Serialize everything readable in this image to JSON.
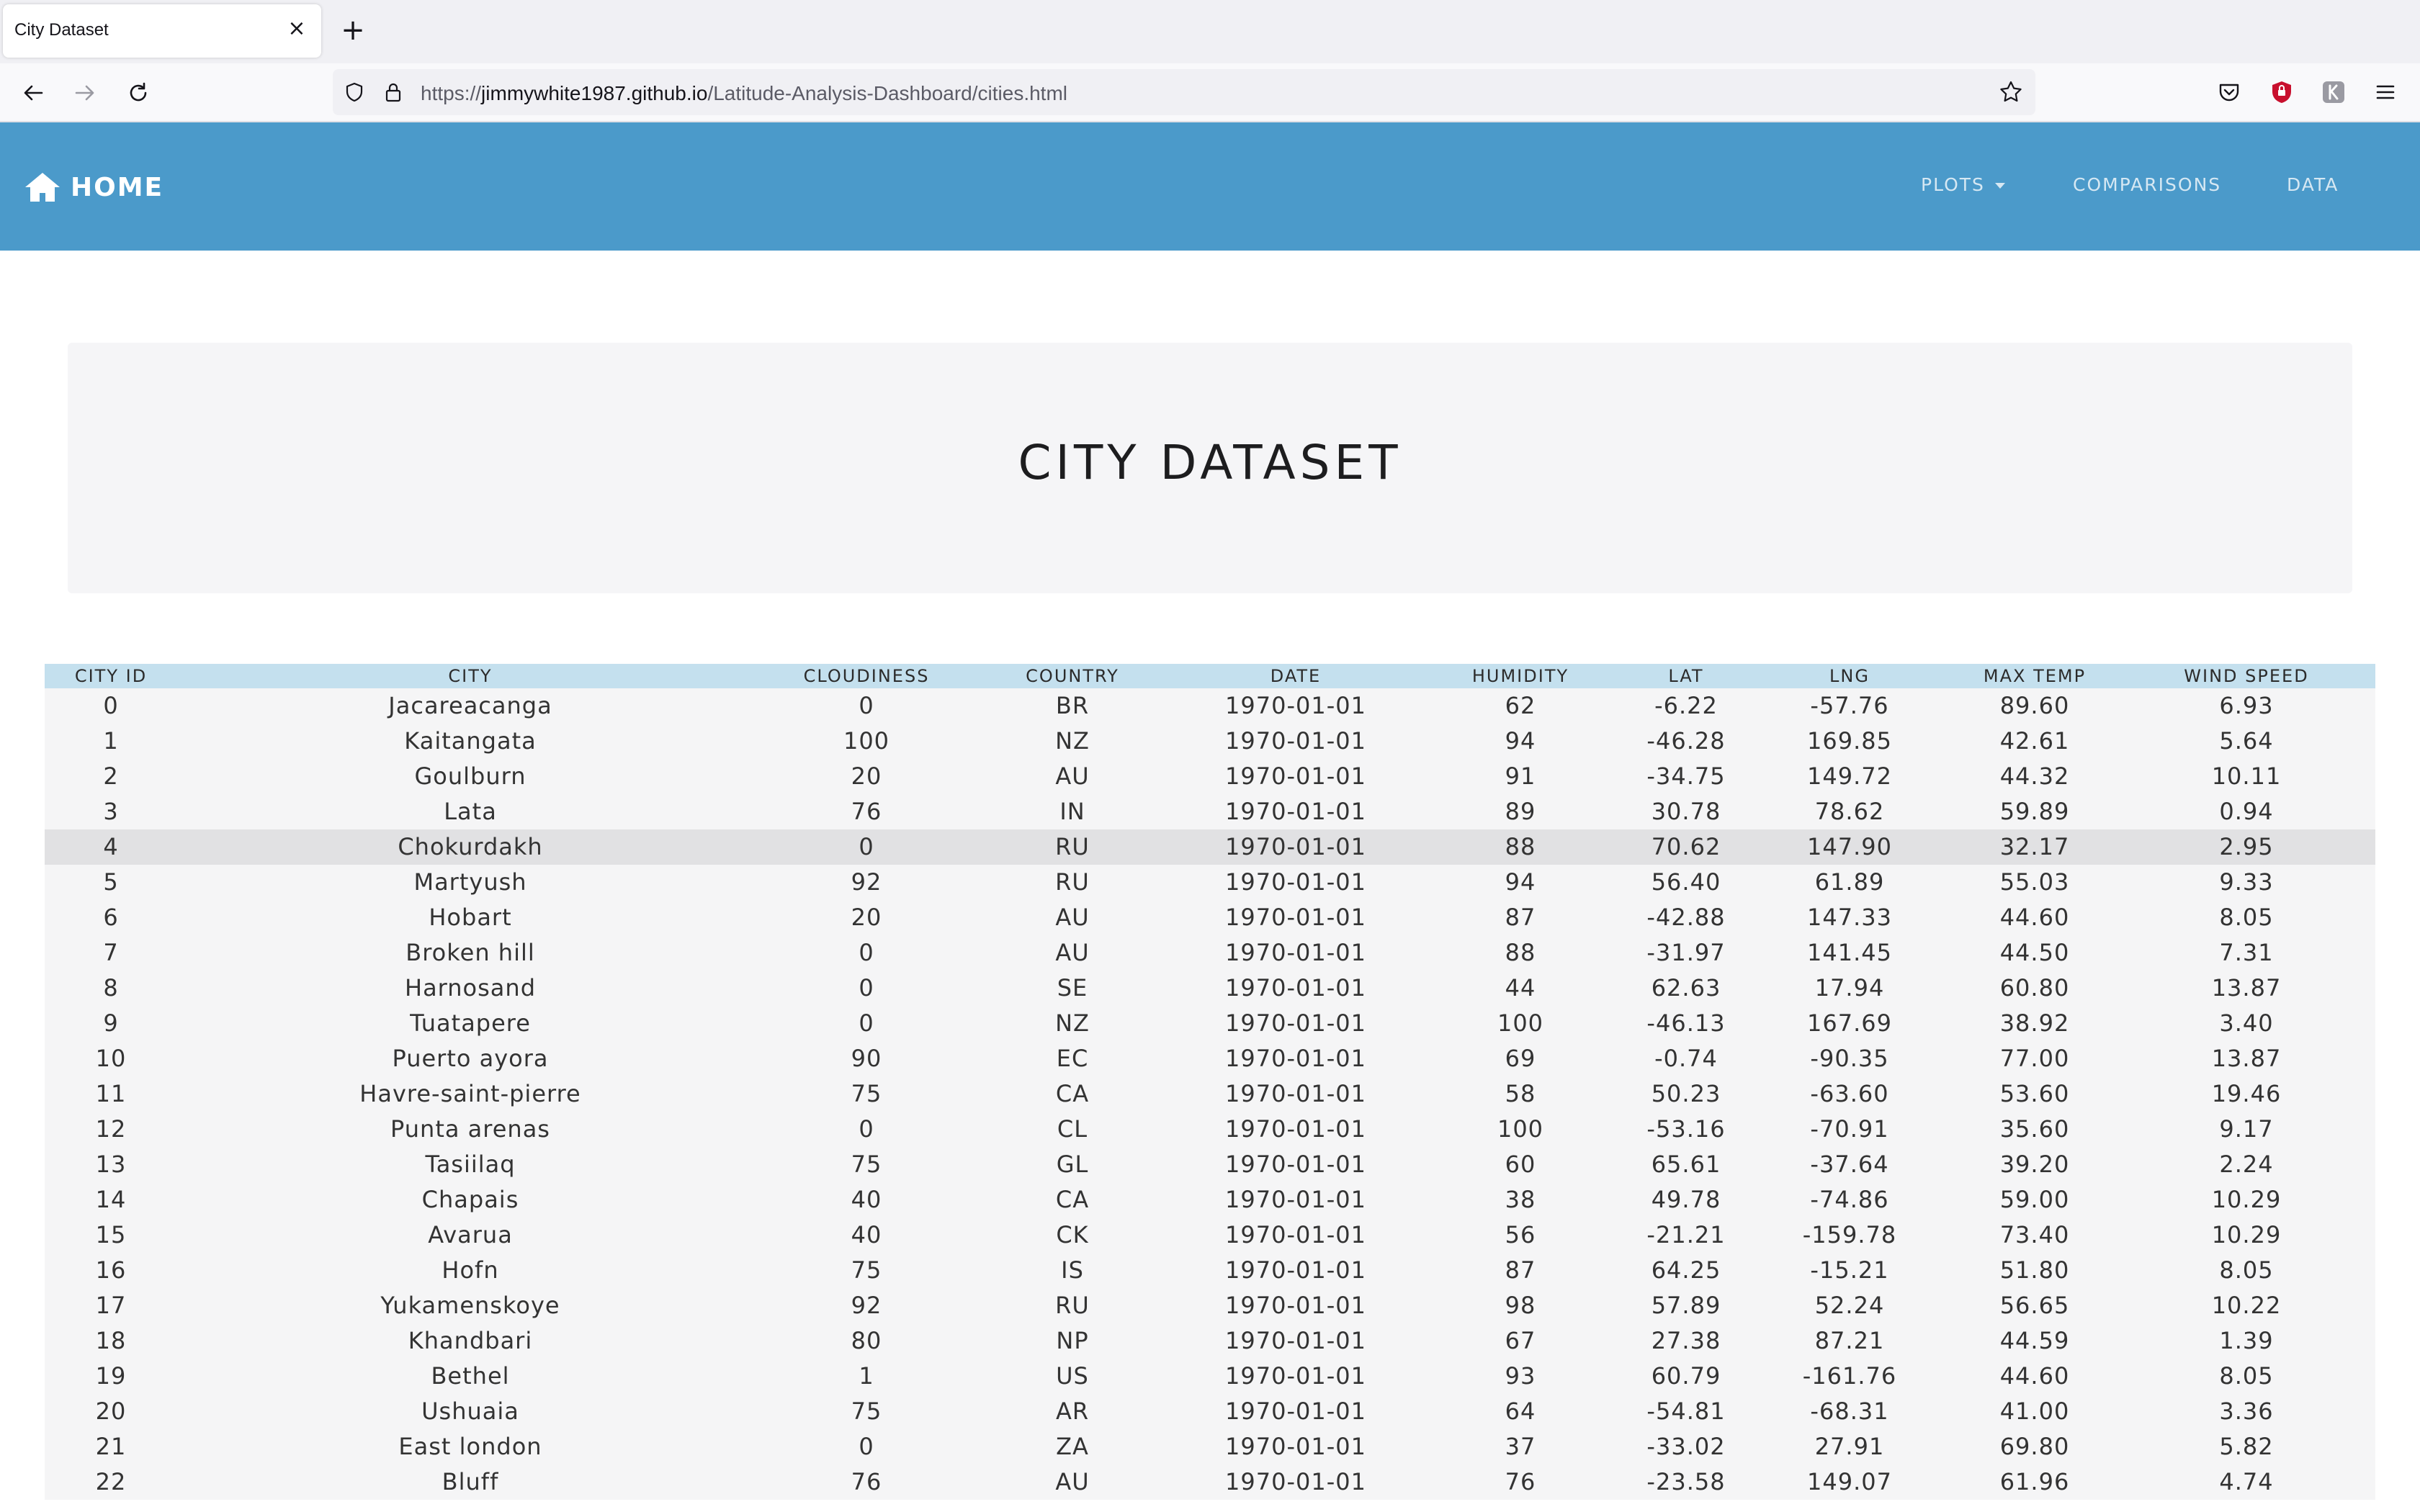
{
  "browser": {
    "tab_title": "City Dataset",
    "url_prefix": "https://",
    "url_host": "jimmywhite1987.github.io",
    "url_path": "/Latitude-Analysis-Dashboard/cities.html"
  },
  "navbar": {
    "brand": "HOME",
    "links": [
      "PLOTS",
      "COMPARISONS",
      "DATA"
    ],
    "color": "#4b9aca"
  },
  "page": {
    "title": "CITY DATASET"
  },
  "table": {
    "columns": [
      "CITY ID",
      "CITY",
      "CLOUDINESS",
      "COUNTRY",
      "DATE",
      "HUMIDITY",
      "LAT",
      "LNG",
      "MAX TEMP",
      "WIND SPEED"
    ],
    "highlighted_row": 4,
    "rows": [
      [
        "0",
        "Jacareacanga",
        "0",
        "BR",
        "1970-01-01",
        "62",
        "-6.22",
        "-57.76",
        "89.60",
        "6.93"
      ],
      [
        "1",
        "Kaitangata",
        "100",
        "NZ",
        "1970-01-01",
        "94",
        "-46.28",
        "169.85",
        "42.61",
        "5.64"
      ],
      [
        "2",
        "Goulburn",
        "20",
        "AU",
        "1970-01-01",
        "91",
        "-34.75",
        "149.72",
        "44.32",
        "10.11"
      ],
      [
        "3",
        "Lata",
        "76",
        "IN",
        "1970-01-01",
        "89",
        "30.78",
        "78.62",
        "59.89",
        "0.94"
      ],
      [
        "4",
        "Chokurdakh",
        "0",
        "RU",
        "1970-01-01",
        "88",
        "70.62",
        "147.90",
        "32.17",
        "2.95"
      ],
      [
        "5",
        "Martyush",
        "92",
        "RU",
        "1970-01-01",
        "94",
        "56.40",
        "61.89",
        "55.03",
        "9.33"
      ],
      [
        "6",
        "Hobart",
        "20",
        "AU",
        "1970-01-01",
        "87",
        "-42.88",
        "147.33",
        "44.60",
        "8.05"
      ],
      [
        "7",
        "Broken hill",
        "0",
        "AU",
        "1970-01-01",
        "88",
        "-31.97",
        "141.45",
        "44.50",
        "7.31"
      ],
      [
        "8",
        "Harnosand",
        "0",
        "SE",
        "1970-01-01",
        "44",
        "62.63",
        "17.94",
        "60.80",
        "13.87"
      ],
      [
        "9",
        "Tuatapere",
        "0",
        "NZ",
        "1970-01-01",
        "100",
        "-46.13",
        "167.69",
        "38.92",
        "3.40"
      ],
      [
        "10",
        "Puerto ayora",
        "90",
        "EC",
        "1970-01-01",
        "69",
        "-0.74",
        "-90.35",
        "77.00",
        "13.87"
      ],
      [
        "11",
        "Havre-saint-pierre",
        "75",
        "CA",
        "1970-01-01",
        "58",
        "50.23",
        "-63.60",
        "53.60",
        "19.46"
      ],
      [
        "12",
        "Punta arenas",
        "0",
        "CL",
        "1970-01-01",
        "100",
        "-53.16",
        "-70.91",
        "35.60",
        "9.17"
      ],
      [
        "13",
        "Tasiilaq",
        "75",
        "GL",
        "1970-01-01",
        "60",
        "65.61",
        "-37.64",
        "39.20",
        "2.24"
      ],
      [
        "14",
        "Chapais",
        "40",
        "CA",
        "1970-01-01",
        "38",
        "49.78",
        "-74.86",
        "59.00",
        "10.29"
      ],
      [
        "15",
        "Avarua",
        "40",
        "CK",
        "1970-01-01",
        "56",
        "-21.21",
        "-159.78",
        "73.40",
        "10.29"
      ],
      [
        "16",
        "Hofn",
        "75",
        "IS",
        "1970-01-01",
        "87",
        "64.25",
        "-15.21",
        "51.80",
        "8.05"
      ],
      [
        "17",
        "Yukamenskoye",
        "92",
        "RU",
        "1970-01-01",
        "98",
        "57.89",
        "52.24",
        "56.65",
        "10.22"
      ],
      [
        "18",
        "Khandbari",
        "80",
        "NP",
        "1970-01-01",
        "67",
        "27.38",
        "87.21",
        "44.59",
        "1.39"
      ],
      [
        "19",
        "Bethel",
        "1",
        "US",
        "1970-01-01",
        "93",
        "60.79",
        "-161.76",
        "44.60",
        "8.05"
      ],
      [
        "20",
        "Ushuaia",
        "75",
        "AR",
        "1970-01-01",
        "64",
        "-54.81",
        "-68.31",
        "41.00",
        "3.36"
      ],
      [
        "21",
        "East london",
        "0",
        "ZA",
        "1970-01-01",
        "37",
        "-33.02",
        "27.91",
        "69.80",
        "5.82"
      ],
      [
        "22",
        "Bluff",
        "76",
        "AU",
        "1970-01-01",
        "76",
        "-23.58",
        "149.07",
        "61.96",
        "4.74"
      ]
    ]
  }
}
